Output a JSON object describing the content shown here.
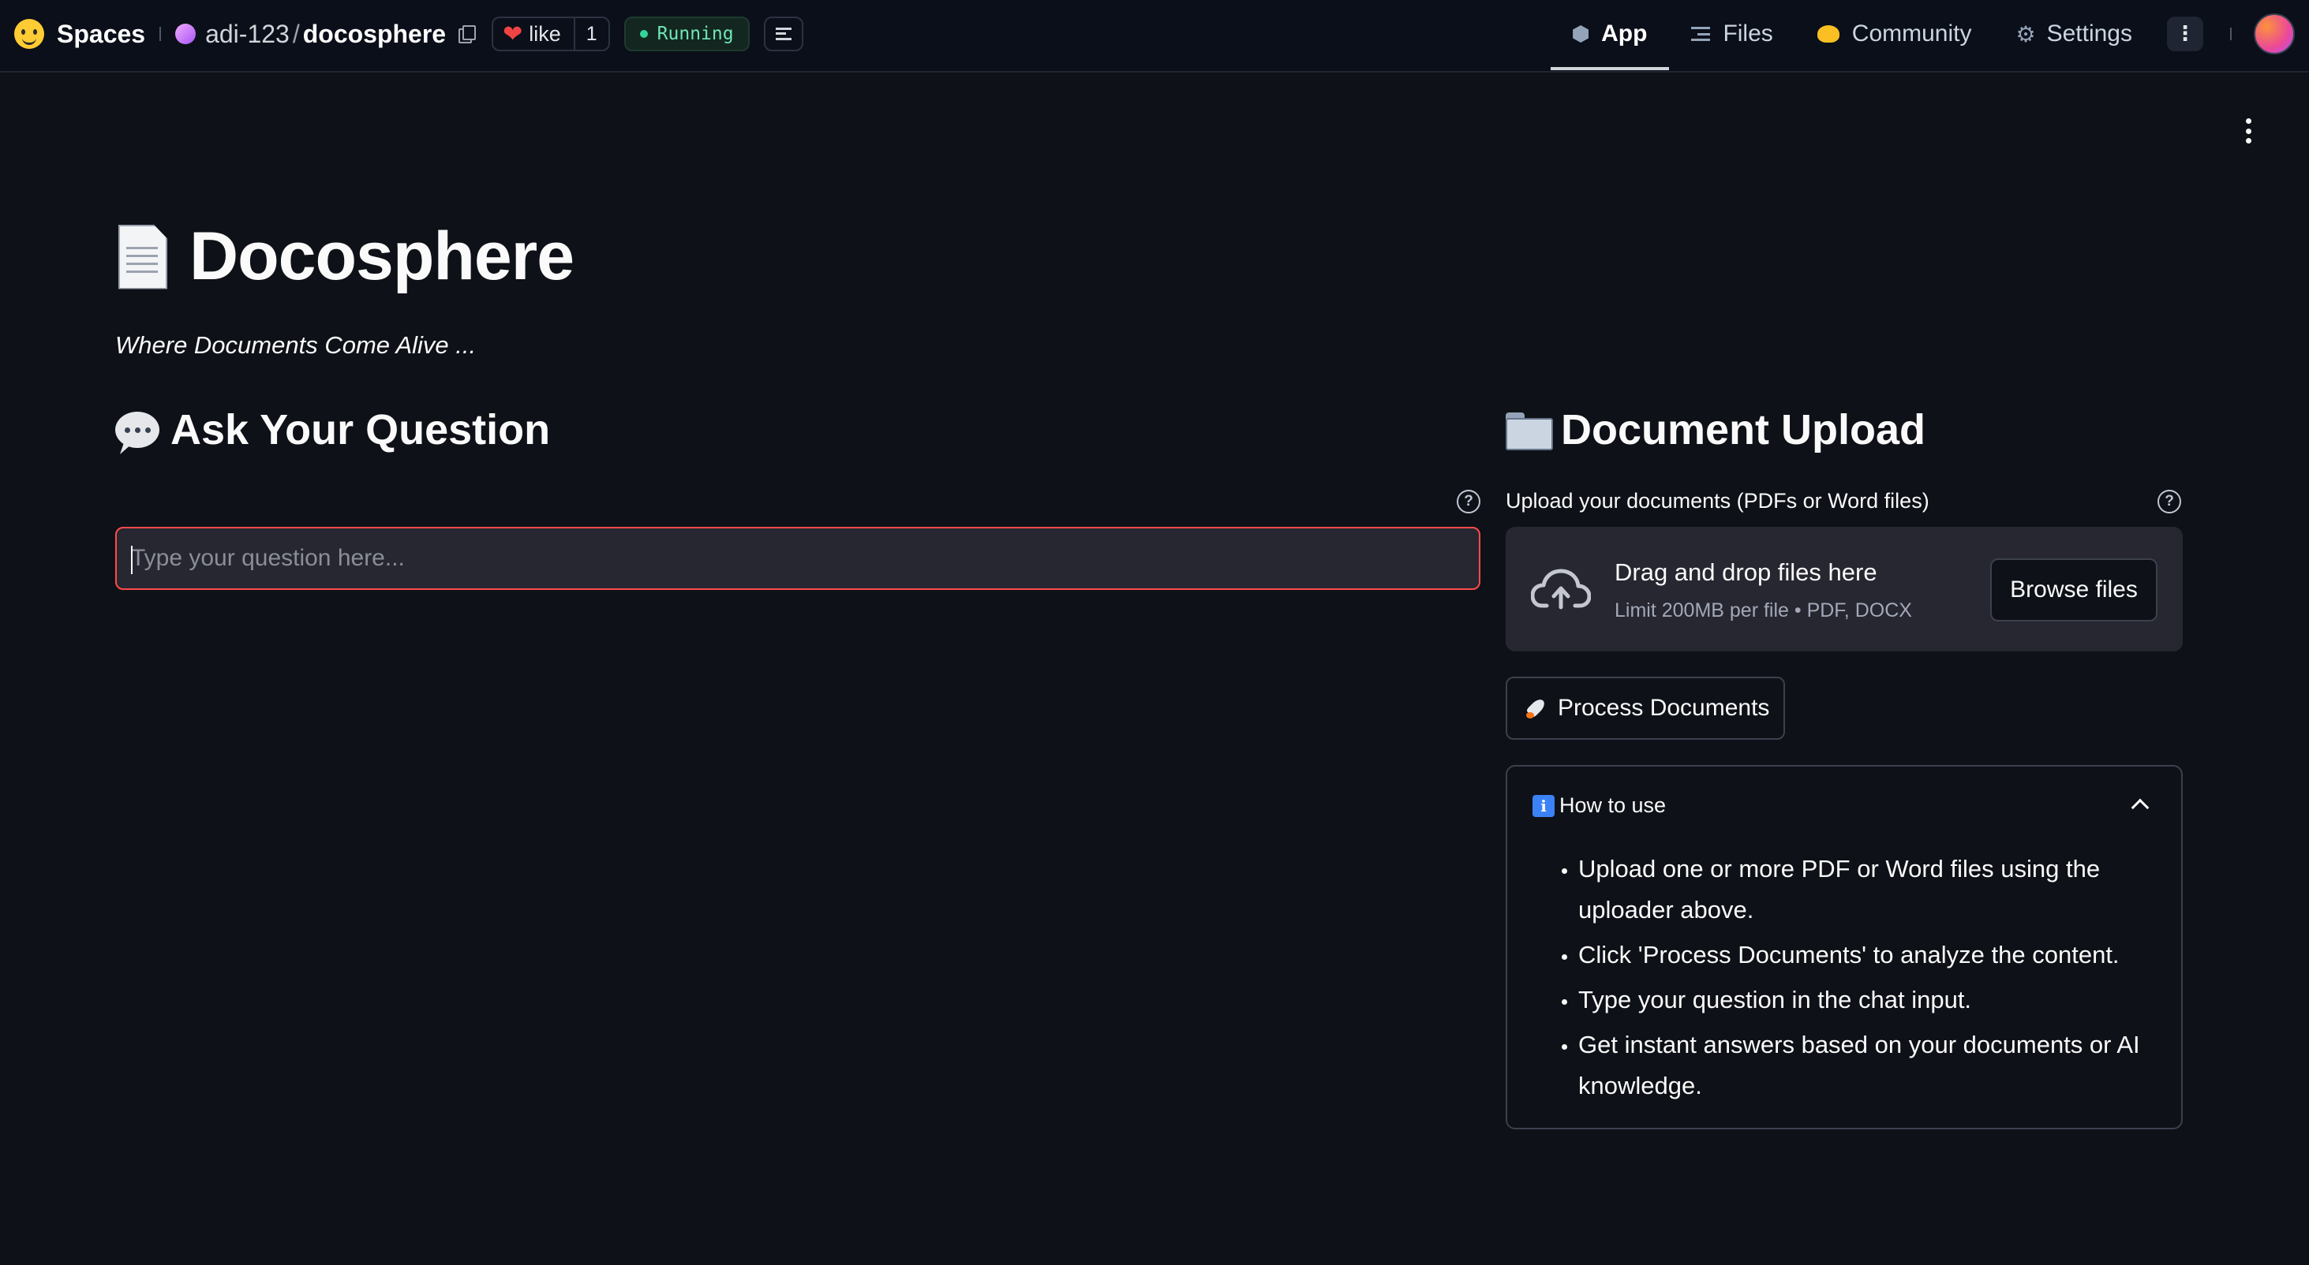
{
  "topbar": {
    "brand": "Spaces",
    "owner": "adi-123",
    "separator": "/",
    "repo": "docosphere",
    "like_label": "like",
    "like_count": "1",
    "status": "Running",
    "tabs": [
      {
        "label": "App",
        "icon": "cube-icon",
        "active": true
      },
      {
        "label": "Files",
        "icon": "files-icon",
        "active": false
      },
      {
        "label": "Community",
        "icon": "community-icon",
        "active": false
      },
      {
        "label": "Settings",
        "icon": "gear-icon",
        "active": false
      }
    ]
  },
  "app": {
    "title": "Docosphere",
    "tagline": "Where Documents Come Alive ...",
    "ask": {
      "heading": "Ask Your Question",
      "placeholder": "Type your question here...",
      "value": ""
    },
    "upload": {
      "heading": "Document Upload",
      "label": "Upload your documents (PDFs or Word files)",
      "drop_title": "Drag and drop files here",
      "drop_sub": "Limit 200MB per file • PDF, DOCX",
      "browse_label": "Browse files",
      "process_label": "Process Documents"
    },
    "howto": {
      "title": "How to use",
      "expanded": true,
      "items": [
        "Upload one or more PDF or Word files using the uploader above.",
        "Click 'Process Documents' to analyze the content.",
        "Type your question in the chat input.",
        "Get instant answers based on your documents or AI knowledge."
      ]
    }
  },
  "colors": {
    "background": "#0e1117",
    "topbar": "#0b0f19",
    "input_bg": "#262730",
    "focus_border": "#ff4b4b",
    "running": "#34d399"
  }
}
